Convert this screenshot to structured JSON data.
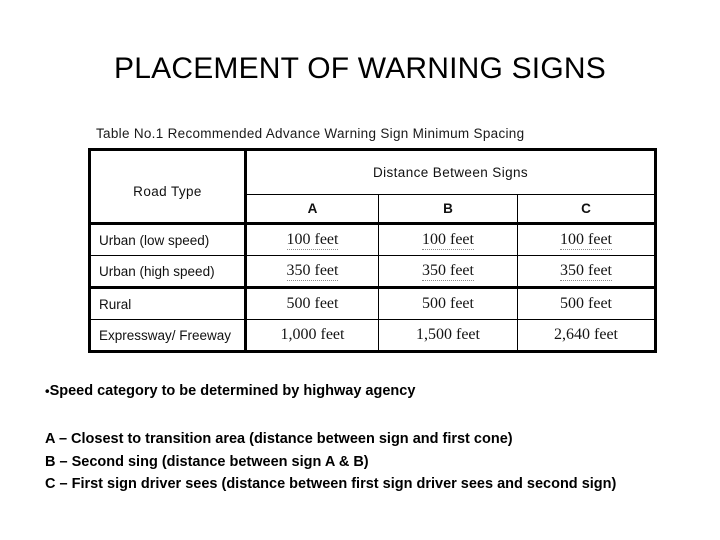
{
  "slide": {
    "title": "PLACEMENT OF WARNING SIGNS",
    "background_color": "#ffffff",
    "text_color": "#000000"
  },
  "table": {
    "caption": "Table No.1 Recommended Advance Warning Sign Minimum Spacing",
    "headers": {
      "road_type": "Road Type",
      "distance_group": "Distance Between Signs",
      "sub_a": "A",
      "sub_b": "B",
      "sub_c": "C"
    },
    "rows": [
      {
        "road_type": "Urban (low speed)",
        "a": "100 feet",
        "b": "100 feet",
        "c": "100 feet"
      },
      {
        "road_type": "Urban (high speed)",
        "a": "350 feet",
        "b": "350 feet",
        "c": "350 feet"
      },
      {
        "road_type": "Rural",
        "a": "500 feet",
        "b": "500 feet",
        "c": "500 feet"
      },
      {
        "road_type": "Expressway/ Freeway",
        "a": "1,000 feet",
        "b": "1,500 feet",
        "c": "2,640 feet"
      }
    ]
  },
  "notes": {
    "bullet_symbol": "•",
    "bullet": "Speed category to be determined by highway agency",
    "legend": [
      "A – Closest to transition area (distance between sign and first cone)",
      "B – Second sing (distance between sign A & B)",
      "C – First sign driver sees (distance between first sign driver sees and second sign)"
    ]
  }
}
